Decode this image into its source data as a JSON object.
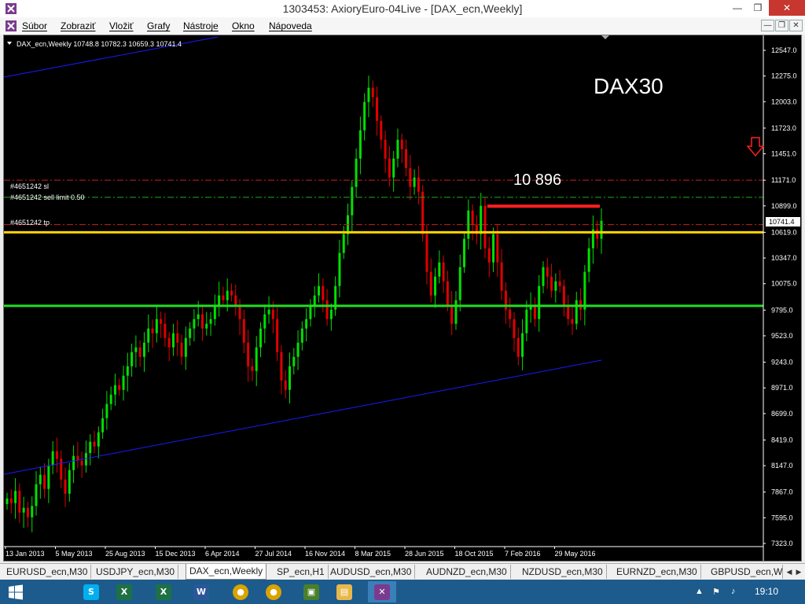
{
  "window": {
    "title": "1303453: AxioryEuro-04Live - [DAX_ecn,Weekly]",
    "minimize": "—",
    "maximize": "❐",
    "close": "✕"
  },
  "menu": {
    "items": [
      "Súbor",
      "Zobraziť",
      "Vložiť",
      "Grafy",
      "Nástroje",
      "Okno",
      "Nápoveda"
    ],
    "mdi_minimize": "—",
    "mdi_restore": "❐",
    "mdi_close": "✕"
  },
  "chart": {
    "header": "DAX_ecn,Weekly  10748.8 10782.3 10659.3 10741.4",
    "annotation_title": "DAX30",
    "annotation_level": "10 896",
    "order_labels": {
      "sl": "#4651242 sl",
      "sell_limit": "#4651242 sell limit 0.50",
      "tp": "#4651242 tp"
    },
    "current_price_label": "10741.4",
    "colors": {
      "background": "#000000",
      "bull": "#00e000",
      "bear": "#e00000",
      "support": "#22dd22",
      "resistance_yellow": "#ffd400",
      "trendline": "#1a1aff",
      "marker": "#ff2020",
      "axis_text": "#ffffff"
    }
  },
  "chart_data": {
    "type": "candlestick",
    "title": "DAX30",
    "symbol": "DAX_ecn,Weekly",
    "ohlc_last": {
      "open": 10748.8,
      "high": 10782.3,
      "low": 10659.3,
      "close": 10741.4
    },
    "y_ticks": [
      12547.0,
      12275.0,
      12003.0,
      11723.0,
      11451.0,
      11171.0,
      10899.0,
      10619.0,
      10347.0,
      10075.0,
      9795.0,
      9523.0,
      9243.0,
      8971.0,
      8699.0,
      8419.0,
      8147.0,
      7867.0,
      7595.0,
      7323.0
    ],
    "ylim": [
      7323.0,
      12547.0
    ],
    "x_ticks": [
      "13 Jan 2013",
      "5 May 2013",
      "25 Aug 2013",
      "15 Dec 2013",
      "6 Apr 2014",
      "27 Jul 2014",
      "16 Nov 2014",
      "8 Mar 2015",
      "28 Jun 2015",
      "18 Oct 2015",
      "7 Feb 2016",
      "29 May 2016"
    ],
    "horizontal_levels": [
      {
        "name": "sl",
        "value": 11171,
        "style": "dash-dot",
        "color": "#c82020"
      },
      {
        "name": "sell limit",
        "value": 10990,
        "style": "dash-dot",
        "color": "#22aa22"
      },
      {
        "name": "tp",
        "value": 10700,
        "style": "dash-dot",
        "color": "#c82020"
      },
      {
        "name": "yellow",
        "value": 10619,
        "style": "solid",
        "color": "#ffd400"
      },
      {
        "name": "green",
        "value": 9840,
        "style": "solid",
        "color": "#22dd22"
      }
    ],
    "level_marker": {
      "value": 10896
    },
    "series_points": [
      7800,
      7750,
      7880,
      7650,
      7700,
      7600,
      7720,
      7950,
      8050,
      7900,
      8150,
      8300,
      8220,
      8000,
      7850,
      8100,
      8250,
      8200,
      8150,
      8280,
      8400,
      8350,
      8500,
      8650,
      8800,
      8900,
      9000,
      8950,
      9100,
      9200,
      9350,
      9400,
      9300,
      9450,
      9600,
      9550,
      9700,
      9650,
      9500,
      9400,
      9550,
      9450,
      9300,
      9500,
      9600,
      9700,
      9750,
      9600,
      9650,
      9700,
      9850,
      9950,
      9900,
      10000,
      9950,
      9850,
      9700,
      9450,
      9200,
      9150,
      9400,
      9600,
      9750,
      9800,
      9700,
      9350,
      9050,
      8950,
      9200,
      9300,
      9450,
      9600,
      9700,
      9850,
      9950,
      10050,
      9900,
      9700,
      9800,
      10050,
      10400,
      10600,
      10800,
      11100,
      11400,
      11700,
      12000,
      12150,
      12050,
      11800,
      11600,
      11400,
      11200,
      11400,
      11600,
      11500,
      11300,
      11100,
      11200,
      11050,
      10600,
      10200,
      9950,
      10150,
      10300,
      10100,
      9850,
      9650,
      9900,
      10250,
      10550,
      10850,
      10700,
      10600,
      10900,
      10450,
      10300,
      10600,
      10300,
      10000,
      9800,
      9700,
      9500,
      9300,
      9550,
      9800,
      9850,
      9700,
      10050,
      10250,
      10150,
      10000,
      10100,
      10050,
      9850,
      9700,
      9650,
      9900,
      9800,
      10200,
      10450,
      10650,
      10550,
      10741
    ]
  },
  "tabs": {
    "items": [
      "EURUSD_ecn,M30",
      "USDJPY_ecn,M30",
      "DAX_ecn,Weekly",
      "SP_ecn,H1",
      "AUDUSD_ecn,M30",
      "AUDNZD_ecn,M30",
      "NZDUSD_ecn,M30",
      "EURNZD_ecn,M30",
      "GBPUSD_ecn,W"
    ],
    "active_index": 2,
    "arrow_left": "◀",
    "arrow_right": "▶"
  },
  "taskbar": {
    "clock": "19:10",
    "apps": [
      {
        "name": "skype-icon",
        "glyph": "S",
        "color": "#00aff0"
      },
      {
        "name": "excel-icon",
        "glyph": "X",
        "color": "#1e7145"
      },
      {
        "name": "word-icon",
        "glyph": "W",
        "color": "#2b579a"
      },
      {
        "name": "chrome-icon",
        "glyph": "●",
        "color": "#d9a300"
      },
      {
        "name": "terminal-icon",
        "glyph": "▣",
        "color": "#4a7f2a"
      },
      {
        "name": "folder-icon",
        "glyph": "▤",
        "color": "#e8b84a"
      },
      {
        "name": "metatrader-icon",
        "glyph": "✕",
        "color": "#7a3b8f"
      }
    ],
    "tray_arrow": "▲",
    "tray_flag": "⚑",
    "tray_speaker": "♪"
  }
}
